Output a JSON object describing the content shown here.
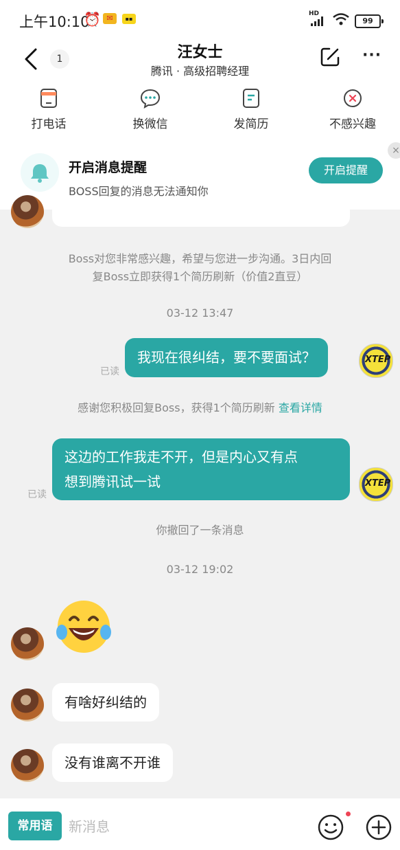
{
  "status_bar": {
    "time": "上午10:10",
    "hd": "HD",
    "battery": "99"
  },
  "header": {
    "back_count": "1",
    "title": "汪女士",
    "subtitle": "腾讯 · 高级招聘经理"
  },
  "actions": [
    {
      "label": "打电话",
      "icon": "phone-icon"
    },
    {
      "label": "换微信",
      "icon": "wechat-icon"
    },
    {
      "label": "发简历",
      "icon": "resume-icon"
    },
    {
      "label": "不感兴趣",
      "icon": "not-interested-icon"
    }
  ],
  "reminder": {
    "title": "开启消息提醒",
    "subtitle": "BOSS回复的消息无法通知你",
    "button": "开启提醒",
    "close": "×"
  },
  "chat": {
    "sys1_line1": "Boss对您非常感兴趣，希望与您进一步沟通。3日内回",
    "sys1_line2": "复Boss立即获得1个简历刷新（价值2直豆）",
    "ts1": "03-12 13:47",
    "msg1": "我现在很纠结，要不要面试？",
    "read1": "已读",
    "sys2": "感谢您积极回复Boss，获得1个简历刷新",
    "sys2_link": "查看详情",
    "msg2_line1": "这边的工作我走不开，但是内心又有点",
    "msg2_line2": "想到腾讯试一试",
    "read2": "已读",
    "recalled": "你撤回了一条消息",
    "ts2": "03-12 19:02",
    "msg3": "有啥好纠结的",
    "msg4": "没有谁离不开谁",
    "my_avatar_logo": "XTEP"
  },
  "bottom_bar": {
    "phrase_button": "常用语",
    "placeholder": "新消息"
  },
  "colors": {
    "accent": "#2aa7a4",
    "background": "#f1f1f1"
  }
}
